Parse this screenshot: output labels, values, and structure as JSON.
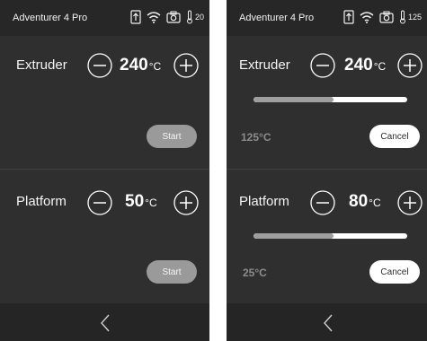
{
  "colors": {
    "screen_bg": "#2f2f2f",
    "bar_bg": "#272727",
    "start_button": "#9a9a9a",
    "progress_fill": "#9e9e9e",
    "progress_track": "#ffffff",
    "muted_text": "#8c8c8c"
  },
  "left": {
    "statusbar": {
      "title": "Adventurer 4 Pro",
      "temp": "20"
    },
    "extruder": {
      "label": "Extruder",
      "value": "240",
      "unit": "°C",
      "button": "Start"
    },
    "platform": {
      "label": "Platform",
      "value": "50",
      "unit": "°C",
      "button": "Start"
    },
    "icons": [
      "usb-icon",
      "wifi-icon",
      "camera-icon",
      "thermometer-icon",
      "minus-icon",
      "plus-icon",
      "back-chevron-icon"
    ]
  },
  "right": {
    "statusbar": {
      "title": "Adventurer 4 Pro",
      "temp": "125"
    },
    "extruder": {
      "label": "Extruder",
      "value": "240",
      "unit": "°C",
      "current": "125°C",
      "button": "Cancel",
      "progress": 0.52
    },
    "platform": {
      "label": "Platform",
      "value": "80",
      "unit": "°C",
      "current": "25°C",
      "button": "Cancel",
      "progress": 0.52
    }
  }
}
